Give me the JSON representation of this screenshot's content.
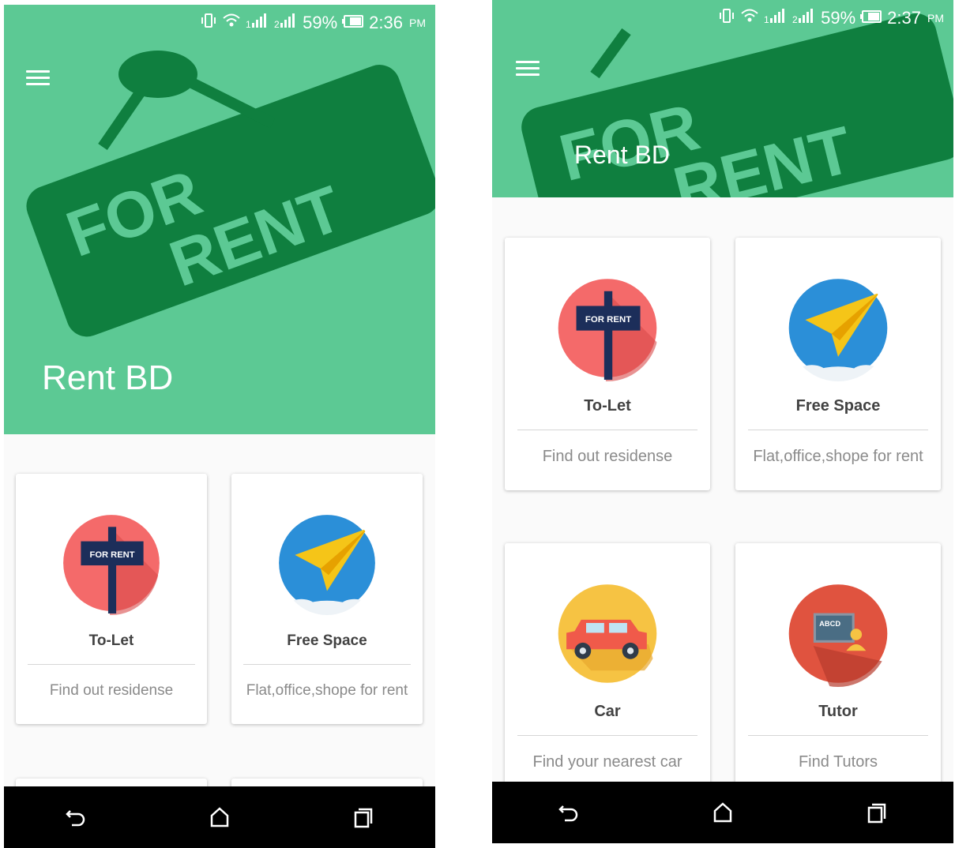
{
  "screens": [
    {
      "status": {
        "battery": "59%",
        "time": "2:36",
        "ampm": "PM"
      },
      "app_title": "Rent BD",
      "cards": [
        {
          "title": "To-Let",
          "subtitle": "Find out residense",
          "icon": "for-rent-sign-icon"
        },
        {
          "title": "Free Space",
          "subtitle": "Flat,office,shope for rent",
          "icon": "paper-plane-icon"
        }
      ]
    },
    {
      "status": {
        "battery": "59%",
        "time": "2:37",
        "ampm": "PM"
      },
      "app_title": "Rent BD",
      "cards": [
        {
          "title": "To-Let",
          "subtitle": "Find out residense",
          "icon": "for-rent-sign-icon"
        },
        {
          "title": "Free Space",
          "subtitle": "Flat,office,shope for rent",
          "icon": "paper-plane-icon"
        },
        {
          "title": "Car",
          "subtitle": "Find your nearest car",
          "icon": "car-icon"
        },
        {
          "title": "Tutor",
          "subtitle": "Find Tutors",
          "icon": "tutor-board-icon"
        }
      ]
    }
  ],
  "hero": {
    "sign_line1": "FOR",
    "sign_line2": "RENT"
  },
  "icon_text": {
    "for_rent": "FOR RENT",
    "board": "ABCD"
  },
  "colors": {
    "appbar": "#5cc994",
    "sign": "#0f7f3f",
    "to_let_bg": "#f46a6a",
    "free_space_bg": "#2b8fd8",
    "car_bg": "#f6c343",
    "tutor_bg": "#e0533f",
    "nav_bar": "#000000"
  }
}
